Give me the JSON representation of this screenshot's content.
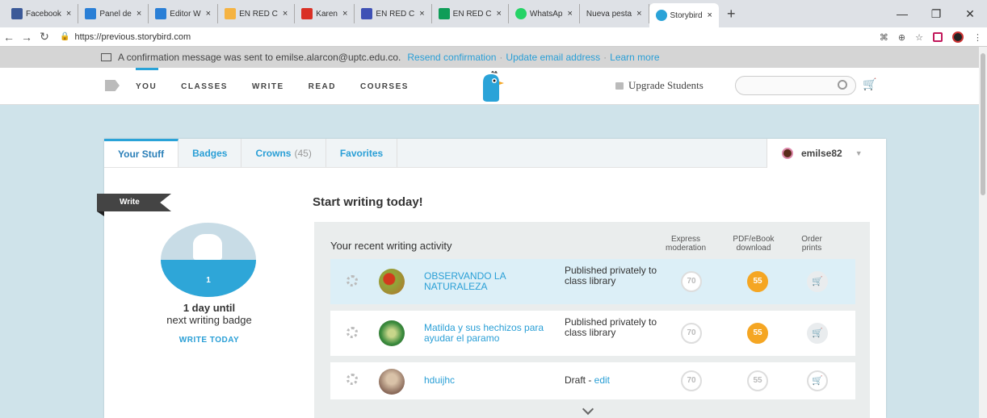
{
  "browser": {
    "tabs": [
      {
        "label": "Facebook",
        "color": "#3b5998"
      },
      {
        "label": "Panel de",
        "color": "#2a7fd6"
      },
      {
        "label": "Editor W",
        "color": "#2a7fd6"
      },
      {
        "label": "EN RED C",
        "color": "#f5b342"
      },
      {
        "label": "Karen",
        "color": "#d93025"
      },
      {
        "label": "EN RED C",
        "color": "#3f51b5"
      },
      {
        "label": "EN RED C",
        "color": "#0f9d58"
      },
      {
        "label": "WhatsAp",
        "color": "#25d366"
      },
      {
        "label": "Nueva pesta",
        "color": "#dee1e6"
      }
    ],
    "active_tab": {
      "label": "Storybird",
      "color": "#2aa3d8"
    },
    "new_tab": "+",
    "close": "×",
    "url": "https://previous.storybird.com",
    "window_controls": [
      "—",
      "❐",
      "✕"
    ]
  },
  "banner": {
    "message": "A confirmation message was sent to emilse.alarcon@uptc.edu.co.",
    "resend": "Resend confirmation",
    "update": "Update email address",
    "learn": "Learn more",
    "separator": "·"
  },
  "nav": {
    "items": [
      "YOU",
      "CLASSES",
      "WRITE",
      "READ",
      "COURSES"
    ],
    "upgrade": "Upgrade Students",
    "search_placeholder": ""
  },
  "tabs": {
    "your_stuff": "Your Stuff",
    "badges": "Badges",
    "crowns": "Crowns",
    "crowns_count": "(45)",
    "favorites": "Favorites",
    "username": "emilse82"
  },
  "left": {
    "write_tag": "Write",
    "badge_number": "1",
    "days_bold": "1 day until",
    "days_rest": "next writing badge",
    "write_today": "WRITE TODAY"
  },
  "right": {
    "heading": "Start writing today!",
    "activity_title": "Your recent writing activity",
    "col_express": "Express moderation",
    "col_pdf": "PDF/eBook download",
    "col_order": "Order prints"
  },
  "rows": [
    {
      "title": "OBSERVANDO LA NATURALEZA",
      "status": "Published privately to class library",
      "express": "70",
      "pdf": "55",
      "thumb": "#b86d2a"
    },
    {
      "title": "Matilda y sus hechizos para ayudar el paramo",
      "status": "Published privately to class library",
      "express": "70",
      "pdf": "55",
      "thumb": "#3a8a3c"
    },
    {
      "title": "hduijhc",
      "status_prefix": "Draft - ",
      "status_edit": "edit",
      "express": "70",
      "pdf": "55",
      "thumb": "#8a6a5a"
    }
  ],
  "colors": {
    "accent": "#2aa3d8",
    "orange": "#f5a623"
  }
}
